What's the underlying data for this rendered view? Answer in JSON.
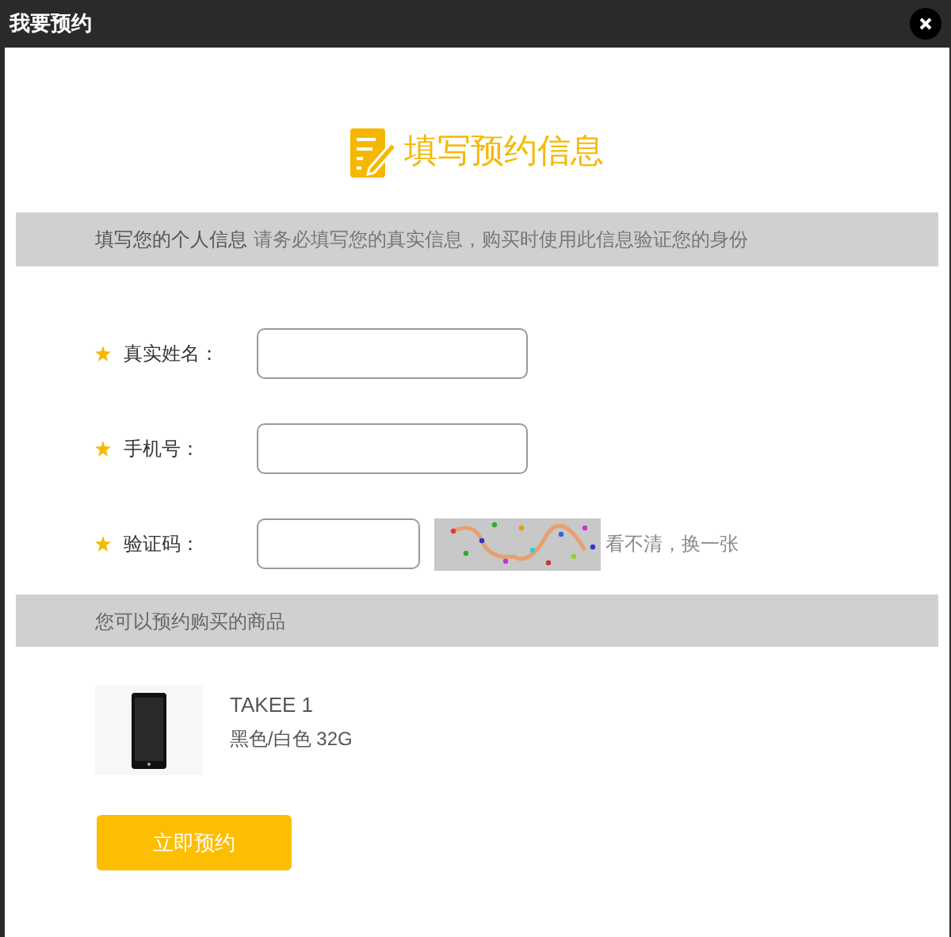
{
  "window": {
    "title": "我要预约"
  },
  "heading": "填写预约信息",
  "info_bar": {
    "title": "填写您的个人信息",
    "hint": "请务必填写您的真实信息，购买时使用此信息验证您的身份"
  },
  "fields": [
    {
      "label": "真实姓名：",
      "required": true,
      "kind": "text"
    },
    {
      "label": "手机号：",
      "required": true,
      "kind": "text"
    },
    {
      "label": "验证码：",
      "required": true,
      "kind": "captcha",
      "refresh": "看不清，换一张"
    }
  ],
  "products_bar": {
    "title": "您可以预约购买的商品"
  },
  "products": [
    {
      "name": "TAKEE 1",
      "spec": "黑色/白色 32G"
    }
  ],
  "submit": "立即预约"
}
